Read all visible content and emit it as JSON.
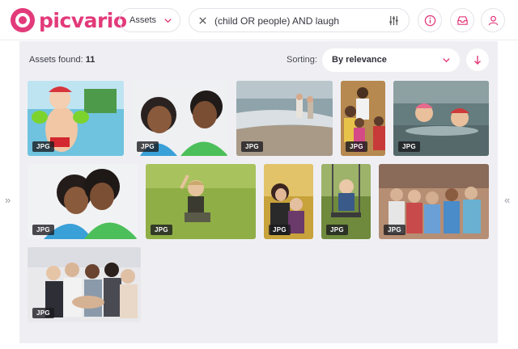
{
  "header": {
    "brand": "picvario",
    "scope_select": "Assets",
    "search_query": "(child OR people) AND laugh"
  },
  "toolbar": {
    "found_label": "Assets found:",
    "found_count": "11",
    "sorting_label": "Sorting:",
    "sorting_value": "By relevance"
  },
  "rails": {
    "left": "»",
    "right": "«"
  },
  "assets": [
    {
      "format": "JPG",
      "icon": "pool-kid-photo"
    },
    {
      "format": "JPG",
      "icon": "laughing-kids-photo"
    },
    {
      "format": "JPG",
      "icon": "beach-kids-photo"
    },
    {
      "format": "JPG",
      "icon": "group-kids-photo"
    },
    {
      "format": "JPG",
      "icon": "kids-in-water-photo"
    },
    {
      "format": "JPG",
      "icon": "hugging-kids-photo"
    },
    {
      "format": "JPG",
      "icon": "girl-on-grass-photo"
    },
    {
      "format": "JPG",
      "icon": "mother-child-photo"
    },
    {
      "format": "JPG",
      "icon": "swing-kid-photo"
    },
    {
      "format": "JPG",
      "icon": "family-group-photo"
    },
    {
      "format": "JPG",
      "icon": "team-hands-photo"
    }
  ],
  "colors": {
    "brand": "#e23a7a",
    "panel": "#efeff3"
  }
}
